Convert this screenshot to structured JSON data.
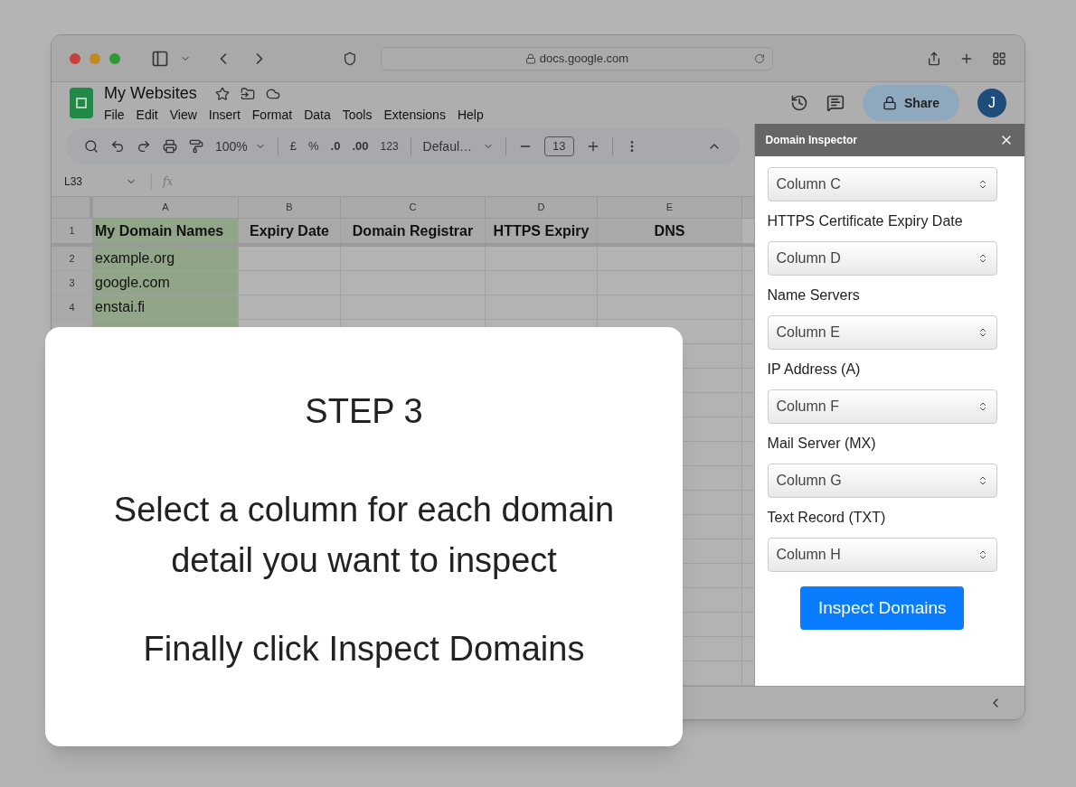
{
  "browser": {
    "url": "docs.google.com"
  },
  "doc": {
    "title": "My Websites",
    "menu": [
      "File",
      "Edit",
      "View",
      "Insert",
      "Format",
      "Data",
      "Tools",
      "Extensions",
      "Help"
    ],
    "share": "Share",
    "avatar": "J"
  },
  "toolbar": {
    "zoom": "100%",
    "currency": "£",
    "percent": "%",
    "decrease_decimals": ".0",
    "increase_decimals": ".00",
    "number_format": "123",
    "font": "Defaul…",
    "font_size": "13"
  },
  "formula_bar": {
    "name_box": "L33",
    "fx": "fx"
  },
  "sheet": {
    "columns": [
      "A",
      "B",
      "C",
      "D",
      "E"
    ],
    "rows": [
      {
        "number": "1",
        "cells": [
          "My Domain Names",
          "Expiry Date",
          "Domain Registrar",
          "HTTPS Expiry",
          "DNS"
        ]
      },
      {
        "number": "2",
        "cells": [
          "example.org",
          "",
          "",
          "",
          ""
        ]
      },
      {
        "number": "3",
        "cells": [
          "google.com",
          "",
          "",
          "",
          ""
        ]
      },
      {
        "number": "4",
        "cells": [
          "enstai.fi",
          "",
          "",
          "",
          ""
        ]
      }
    ]
  },
  "sidebar": {
    "title": "Domain Inspector",
    "fields": [
      {
        "value": "Column C"
      },
      {
        "label": "HTTPS Certificate Expiry Date",
        "value": "Column D"
      },
      {
        "label": "Name Servers",
        "value": "Column E"
      },
      {
        "label": "IP Address (A)",
        "value": "Column F"
      },
      {
        "label": "Mail Server (MX)",
        "value": "Column G"
      },
      {
        "label": "Text Record (TXT)",
        "value": "Column H"
      }
    ],
    "button": "Inspect Domains"
  },
  "card": {
    "heading": "STEP 3",
    "lines": [
      "Select a column for each domain detail you want to inspect",
      "Finally click Inspect Domains"
    ]
  }
}
